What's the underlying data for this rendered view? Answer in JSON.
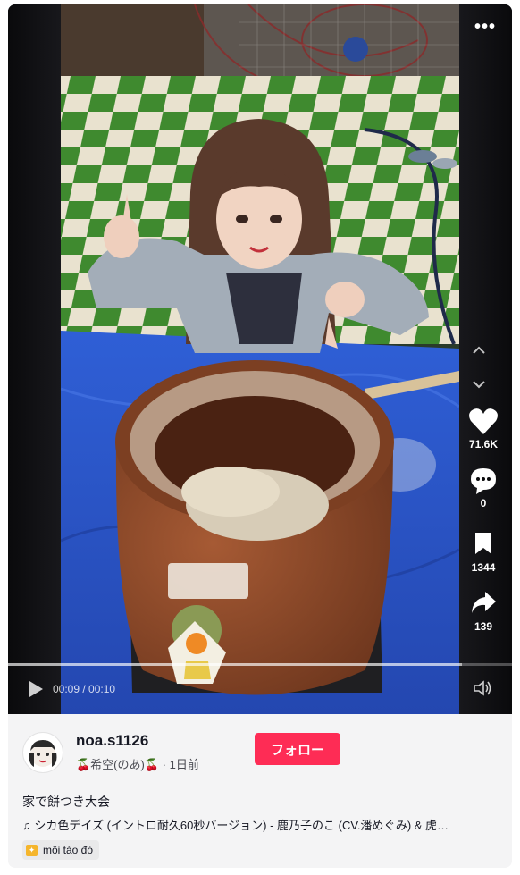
{
  "video": {
    "time_current": "00:09",
    "time_total": "00:10",
    "progress": 0.9
  },
  "actions": {
    "likes": "71.6K",
    "comments": "0",
    "saves": "1344",
    "shares": "139"
  },
  "author": {
    "username": "noa.s1126",
    "nickname": "🍒希空(のあ)🍒",
    "date": "· 1日前",
    "follow_label": "フォロー"
  },
  "post": {
    "description": "家で餅つき大会",
    "music_icon": "♫",
    "music": "シカ色デイズ (イントロ耐久60秒バージョン) - 鹿乃子のこ (CV.潘めぐみ) & 虎…",
    "tag": "môi táo đỏ"
  },
  "icons": {
    "more": "more-icon",
    "up": "chevron-up-icon",
    "down": "chevron-down-icon",
    "like": "heart-icon",
    "comment": "comment-icon",
    "save": "bookmark-icon",
    "share": "share-icon",
    "play": "play-icon",
    "volume": "volume-icon"
  },
  "colors": {
    "follow": "#fe2c55",
    "tarp": "#2f56c8",
    "mortar": "#8a4a2a"
  }
}
